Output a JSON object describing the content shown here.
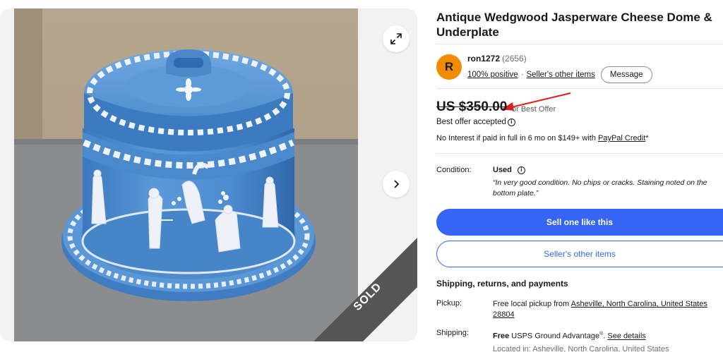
{
  "gallery": {
    "expand_icon": "expand-arrows-icon",
    "next_icon": "chevron-right-icon",
    "sold_label": "SOLD",
    "photo_subject": "cheese-dome-photo"
  },
  "listing": {
    "title": "Antique Wedgwood Jasperware Cheese Dome & Underplate"
  },
  "seller": {
    "avatar_letter": "R",
    "name": "ron1272",
    "feedback_count": "(2656)",
    "positive": "100% positive",
    "separator": "·",
    "other_items_link": "Seller's other items",
    "message_button": "Message"
  },
  "pricing": {
    "price": "US $350.00",
    "or_best_offer": "or Best Offer",
    "best_offer_accepted": "Best offer accepted",
    "financing_prefix": "No Interest if paid in full in 6 mo on $149+ with ",
    "financing_link": "PayPal Credit",
    "financing_suffix": "*"
  },
  "condition": {
    "label": "Condition:",
    "value": "Used",
    "description": "“In very good condition. No chips or cracks. Staining noted on the bottom plate.”"
  },
  "actions": {
    "sell_one_like_this": "Sell one like this",
    "sellers_other_items": "Seller's other items"
  },
  "shipping": {
    "heading": "Shipping, returns, and payments",
    "pickup_label": "Pickup:",
    "pickup_prefix": "Free local pickup from ",
    "pickup_location": "Asheville, North Carolina, United States",
    "pickup_zip": "28804",
    "shipping_label": "Shipping:",
    "shipping_free": "Free",
    "shipping_service": " USPS Ground Advantage",
    "shipping_reg": "®",
    "shipping_sep": ". ",
    "see_details": "See details",
    "located_in": "Located in: Asheville, North Carolina, United States"
  },
  "colors": {
    "accent_blue": "#3665f3",
    "avatar_orange": "#f18c00",
    "annotation_red": "#e31b1b",
    "sold_ribbon": "#555555"
  }
}
